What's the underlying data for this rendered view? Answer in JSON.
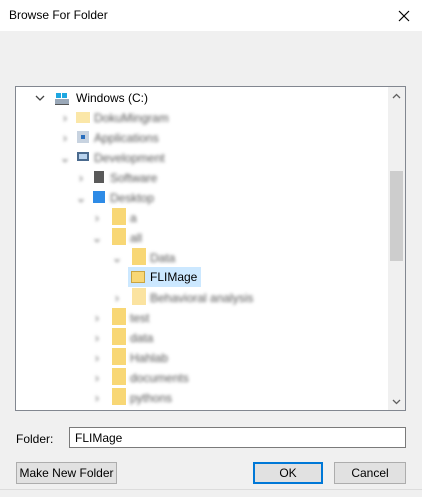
{
  "window": {
    "title": "Browse For Folder"
  },
  "tree": {
    "root_label": "Windows (C:)",
    "blurred_items": [
      "DokuMingram",
      "Applications",
      "Development",
      "Software",
      "Desktop",
      "a",
      "all",
      "Data",
      "Behavioral analysis",
      "test",
      "data",
      "Hahlab",
      "documents",
      "pythons"
    ],
    "selected_label": "FLIMage"
  },
  "folder_field": {
    "label": "Folder:",
    "value": "FLIMage"
  },
  "buttons": {
    "make_new_folder": "Make New Folder",
    "ok": "OK",
    "cancel": "Cancel"
  },
  "colors": {
    "selection": "#cce8ff",
    "folder": "#f8d775",
    "accent": "#0078d7"
  }
}
